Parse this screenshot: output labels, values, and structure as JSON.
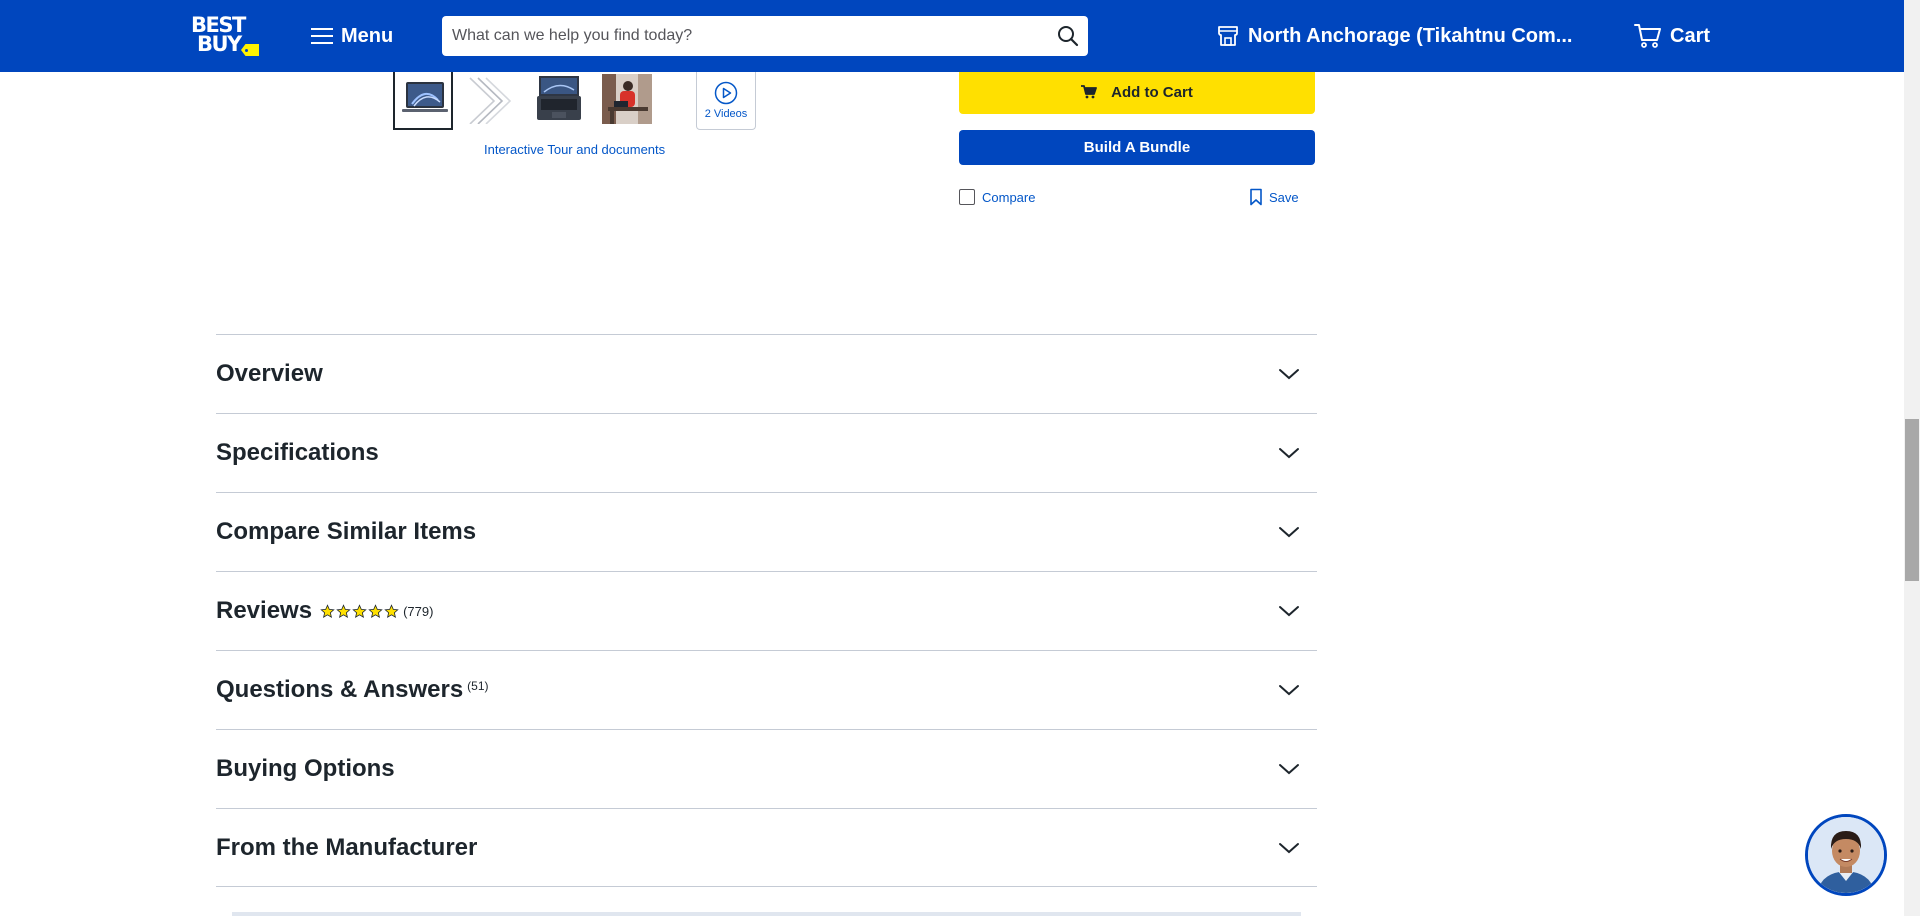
{
  "header": {
    "logo_line1": "BEST",
    "logo_line2": "BUY",
    "menu_label": "Menu",
    "search_placeholder": "What can we help you find today?",
    "store_label": "North Anchorage (Tikahtnu Com...",
    "cart_label": "Cart",
    "brand_color": "#0046be",
    "accent_color": "#fff200"
  },
  "gallery": {
    "thumbnails": [
      "laptop-front",
      "laptop-profile",
      "laptop-keyboard",
      "person-using-laptop"
    ],
    "selected_index": 0,
    "videos_label": "2 Videos",
    "tour_link": "Interactive Tour and documents"
  },
  "buy_box": {
    "add_to_cart": "Add to Cart",
    "build_bundle": "Build A Bundle",
    "compare": "Compare",
    "save": "Save"
  },
  "accordion": {
    "overview": "Overview",
    "specifications": "Specifications",
    "compare_similar": "Compare Similar Items",
    "reviews": "Reviews",
    "reviews_count": "(779)",
    "reviews_rating": 5,
    "qa": "Questions & Answers",
    "qa_count": "(51)",
    "buying_options": "Buying Options",
    "from_manufacturer": "From the Manufacturer"
  },
  "icons": {
    "menu": "hamburger-icon",
    "search": "search-icon",
    "store": "store-icon",
    "cart": "cart-icon",
    "play": "play-icon",
    "bookmark": "bookmark-icon",
    "chevron": "chevron-down-icon",
    "star": "star-icon"
  }
}
